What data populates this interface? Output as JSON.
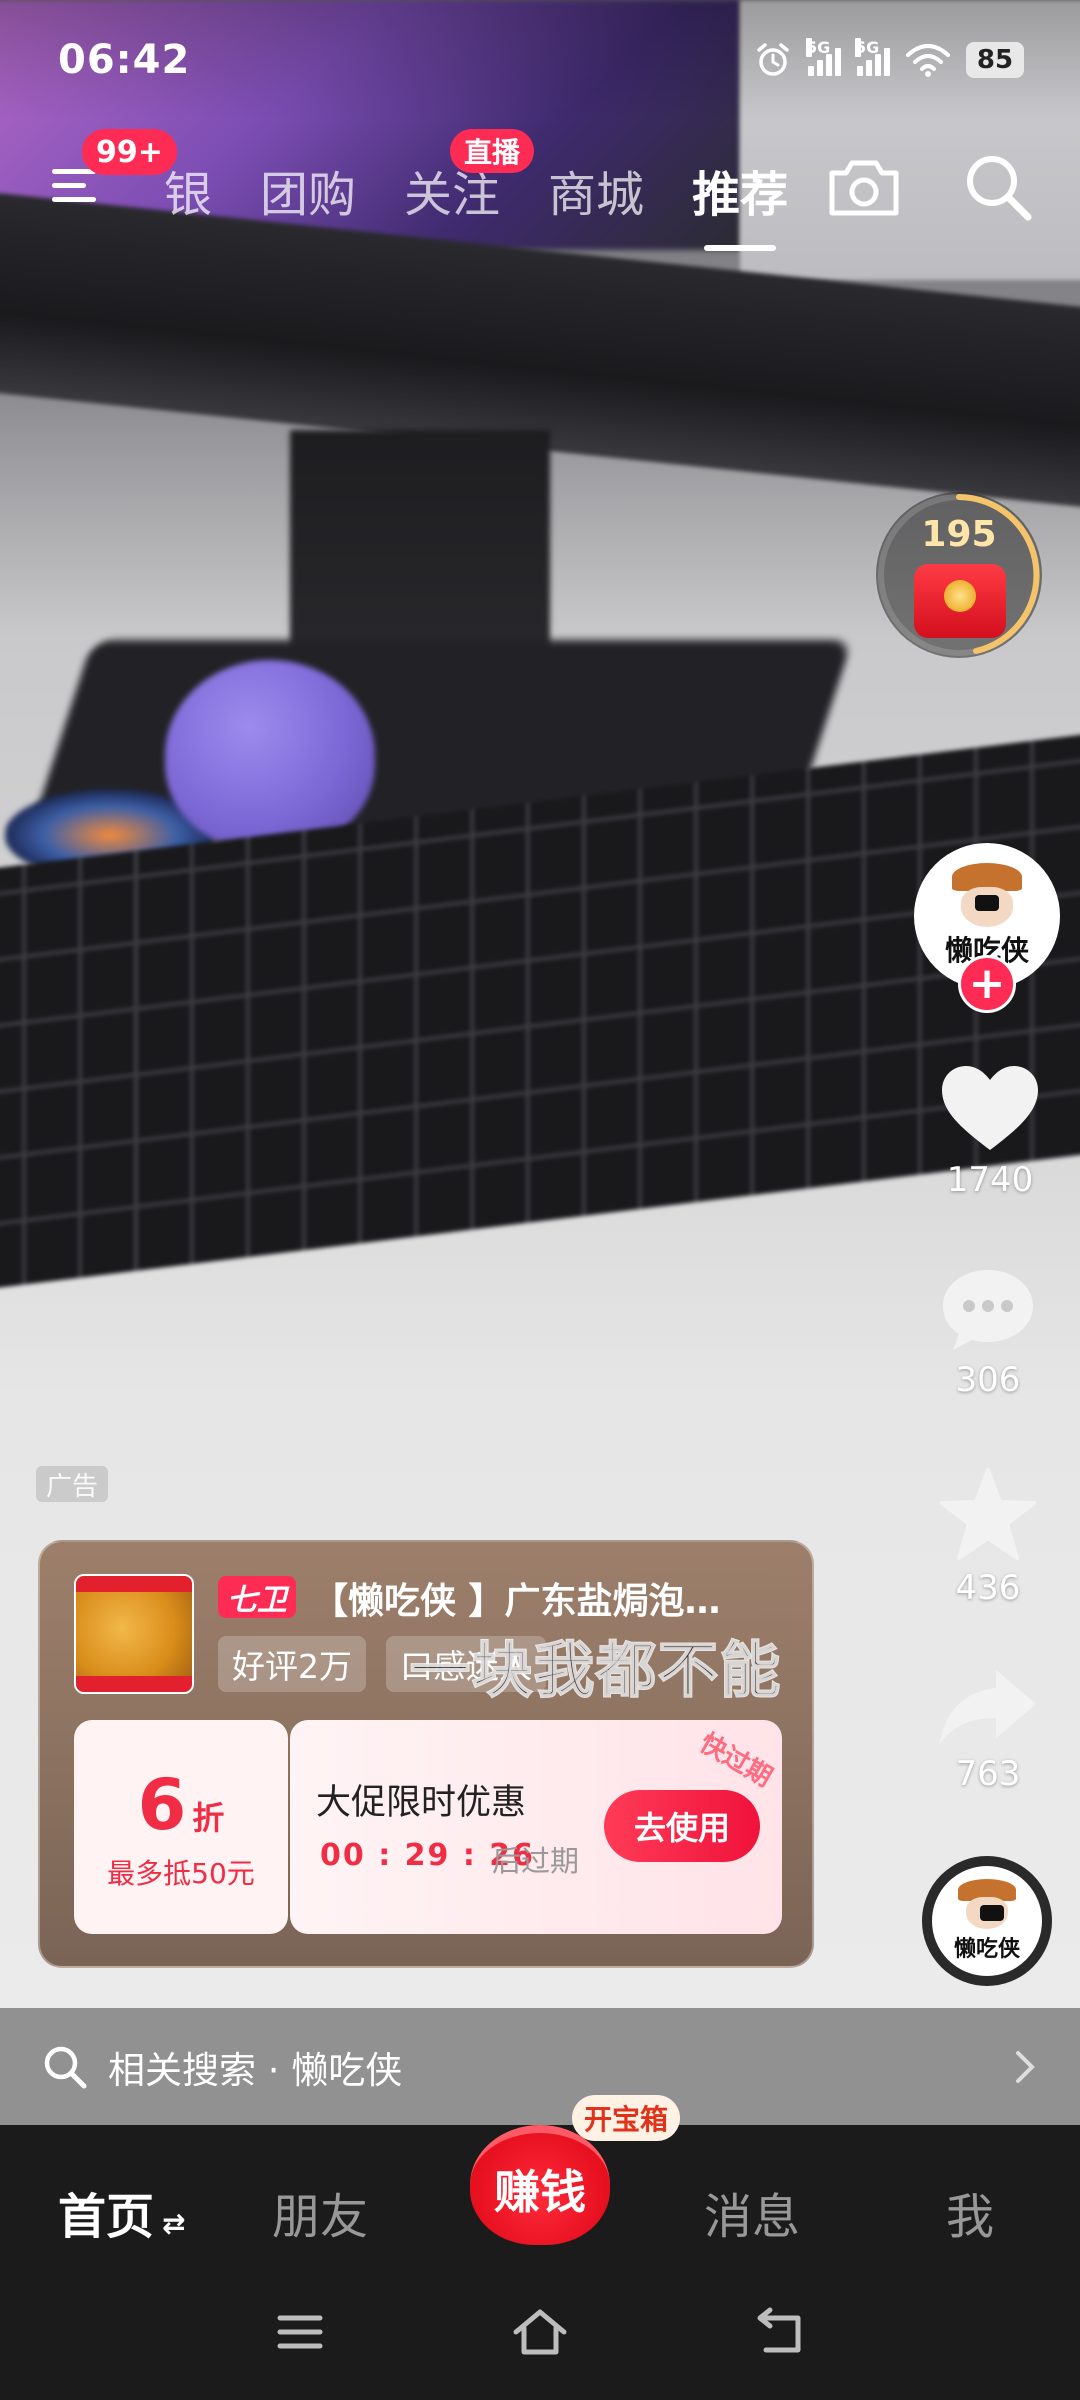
{
  "status_bar": {
    "time": "06:42",
    "network1": "5G",
    "network2": "5G",
    "battery": "85",
    "icons": [
      "alarm-icon",
      "signal-icon",
      "signal-icon",
      "wifi-icon",
      "battery-icon"
    ]
  },
  "top_nav": {
    "menu_badge": "99+",
    "tabs": [
      {
        "label": "银",
        "active": false
      },
      {
        "label": "团购",
        "active": false
      },
      {
        "label": "关注",
        "active": false,
        "badge": "直播"
      },
      {
        "label": "商城",
        "active": false
      },
      {
        "label": "推荐",
        "active": true
      }
    ],
    "icons": [
      "menu-icon",
      "camera-icon",
      "search-icon"
    ]
  },
  "rail": {
    "red_packet_count": "195",
    "creator_avatar_text": "懒吃侠",
    "follow_plus": "+",
    "likes": "1740",
    "comments": "306",
    "favorites": "436",
    "shares": "763",
    "music_avatar_text": "懒吃侠"
  },
  "ad": {
    "label": "广告",
    "brand_logo": "七卫",
    "title": "【懒吃侠 】广东盐焗泡…",
    "tags": [
      "好评2万",
      "口感迷人"
    ],
    "subtitle_overlay": "一块我都不能放过",
    "coupon": {
      "discount_number": "6",
      "discount_unit": "折",
      "max_deduct": "最多抵50元",
      "title": "大促限时优惠",
      "countdown": "00 : 29 : 26",
      "countdown_suffix": "后过期",
      "button": "去使用",
      "ribbon": "快过期"
    }
  },
  "related_search": {
    "label": "相关搜索 · 懒吃侠"
  },
  "bottom_tabs": {
    "home": "首页",
    "friends": "朋友",
    "earn": "赚钱",
    "earn_badge": "开宝箱",
    "messages": "消息",
    "me": "我"
  },
  "colors": {
    "accent": "#fe2c55",
    "coupon_red": "#f02d45",
    "bar_bg": "#1b1b1b"
  }
}
